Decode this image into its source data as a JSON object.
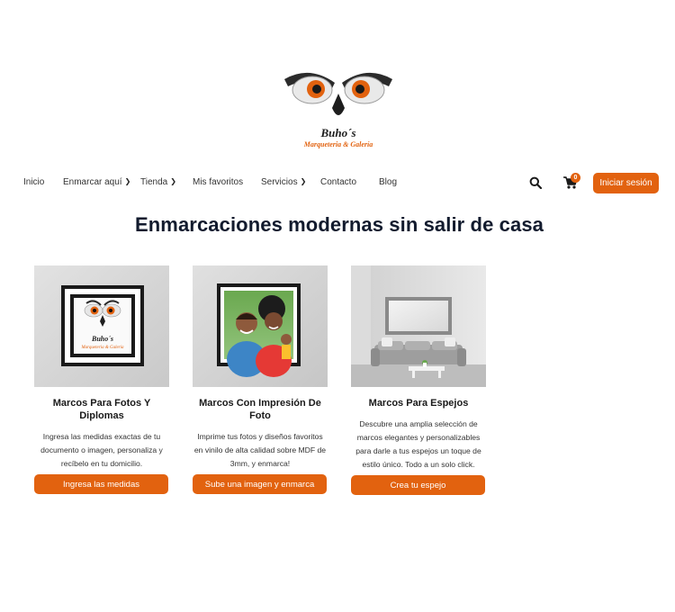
{
  "brand": {
    "logo_line1": "Buho´s",
    "logo_line2": "Marqueteria & Galería"
  },
  "nav": {
    "items": [
      {
        "label": "Inicio",
        "dropdown": false
      },
      {
        "label": "Enmarcar aquí",
        "dropdown": true
      },
      {
        "label": "Tienda",
        "dropdown": true
      },
      {
        "label": "Mis favoritos",
        "dropdown": false
      },
      {
        "label": "Servicios",
        "dropdown": true
      },
      {
        "label": "Contacto",
        "dropdown": false
      },
      {
        "label": "Blog",
        "dropdown": false
      }
    ],
    "cart_count": "0",
    "login_label": "Iniciar sesión"
  },
  "main": {
    "title": "Enmarcaciones modernas sin salir de casa",
    "cards": [
      {
        "title": "Marcos Para Fotos Y Diplomas",
        "description": "Ingresa las medidas exactas de tu documento o imagen, personaliza y recíbelo en tu domicilio.",
        "button": "Ingresa las medidas",
        "image": "framed-logo"
      },
      {
        "title": "Marcos Con Impresión De Foto",
        "description": "Imprime tus fotos y diseños favoritos en vinilo de alta calidad sobre MDF de 3mm, y enmarca!",
        "button": "Sube una imagen y enmarca",
        "image": "framed-family-photo"
      },
      {
        "title": "Marcos Para Espejos",
        "description": "Descubre una amplia selección de marcos elegantes y personalizables para darle a tus espejos un toque de estilo único. Todo a un solo click.",
        "button": "Crea tu espejo",
        "image": "living-room-mirror"
      }
    ]
  },
  "colors": {
    "accent": "#e2620f",
    "title": "#121b2e"
  }
}
